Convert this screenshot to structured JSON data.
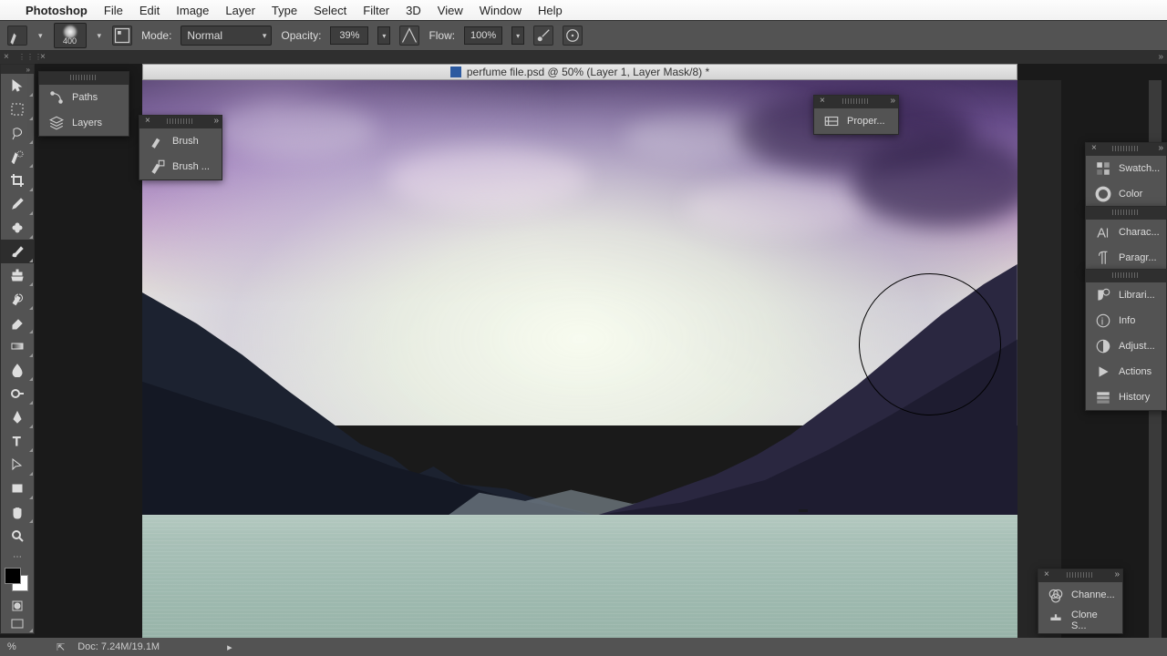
{
  "menubar": {
    "app": "Photoshop",
    "items": [
      "File",
      "Edit",
      "Image",
      "Layer",
      "Type",
      "Select",
      "Filter",
      "3D",
      "View",
      "Window",
      "Help"
    ]
  },
  "options": {
    "brush_size": "400",
    "mode_label": "Mode:",
    "mode_value": "Normal",
    "opacity_label": "Opacity:",
    "opacity_value": "39%",
    "flow_label": "Flow:",
    "flow_value": "100%"
  },
  "document": {
    "title": "perfume file.psd @ 50% (Layer 1, Layer Mask/8) *"
  },
  "panels": {
    "paths": "Paths",
    "layers": "Layers",
    "brush": "Brush",
    "brush_presets": "Brush ...",
    "properties": "Proper...",
    "swatches": "Swatch...",
    "color": "Color",
    "character": "Charac...",
    "paragraph": "Paragr...",
    "libraries": "Librari...",
    "info": "Info",
    "adjustments": "Adjust...",
    "actions": "Actions",
    "history": "History",
    "channels": "Channe...",
    "clone": "Clone S..."
  },
  "status": {
    "zoom": "%",
    "doc": "Doc: 7.24M/19.1M"
  },
  "tools": [
    "move",
    "marquee",
    "lasso",
    "wand",
    "crop",
    "eyedropper",
    "spot-heal",
    "brush",
    "stamp",
    "history-brush",
    "eraser",
    "gradient",
    "blur",
    "dodge",
    "pen",
    "type",
    "path-select",
    "rectangle",
    "hand",
    "zoom"
  ],
  "colors": {
    "fg": "#000000",
    "bg": "#ffffff"
  }
}
